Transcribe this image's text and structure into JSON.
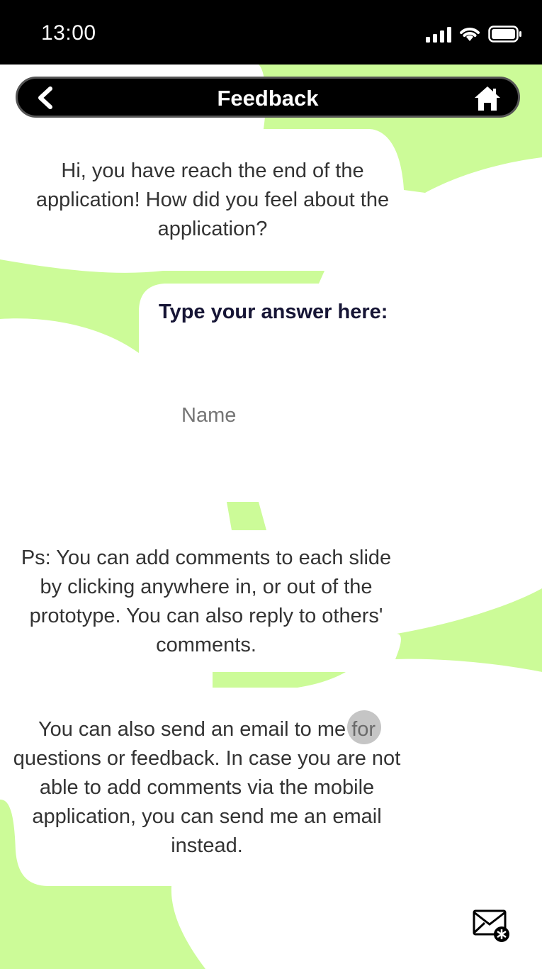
{
  "status_bar": {
    "time": "13:00",
    "icons": [
      "signal-icon",
      "wifi-icon",
      "battery-icon"
    ]
  },
  "header": {
    "title": "Feedback",
    "back_icon": "chevron-left-icon",
    "home_icon": "home-icon"
  },
  "content": {
    "intro": "Hi, you have reach the end of the application! How did you feel about the application?",
    "answer_prompt": "Type your answer here:",
    "name_placeholder": "Name",
    "ps_note": "Ps: You can add comments to each slide by clicking anywhere in, or out of the prototype. You can also reply to others' comments.",
    "email_note": "You can also send an email to me for questions or feedback. In case you are not able to add comments via the mobile application, you can send me an email instead."
  },
  "footer": {
    "mail_icon": "mail-icon"
  },
  "colors": {
    "accent_green": "#ccfb98",
    "bar_black": "#000000",
    "prompt_navy": "#161535"
  }
}
